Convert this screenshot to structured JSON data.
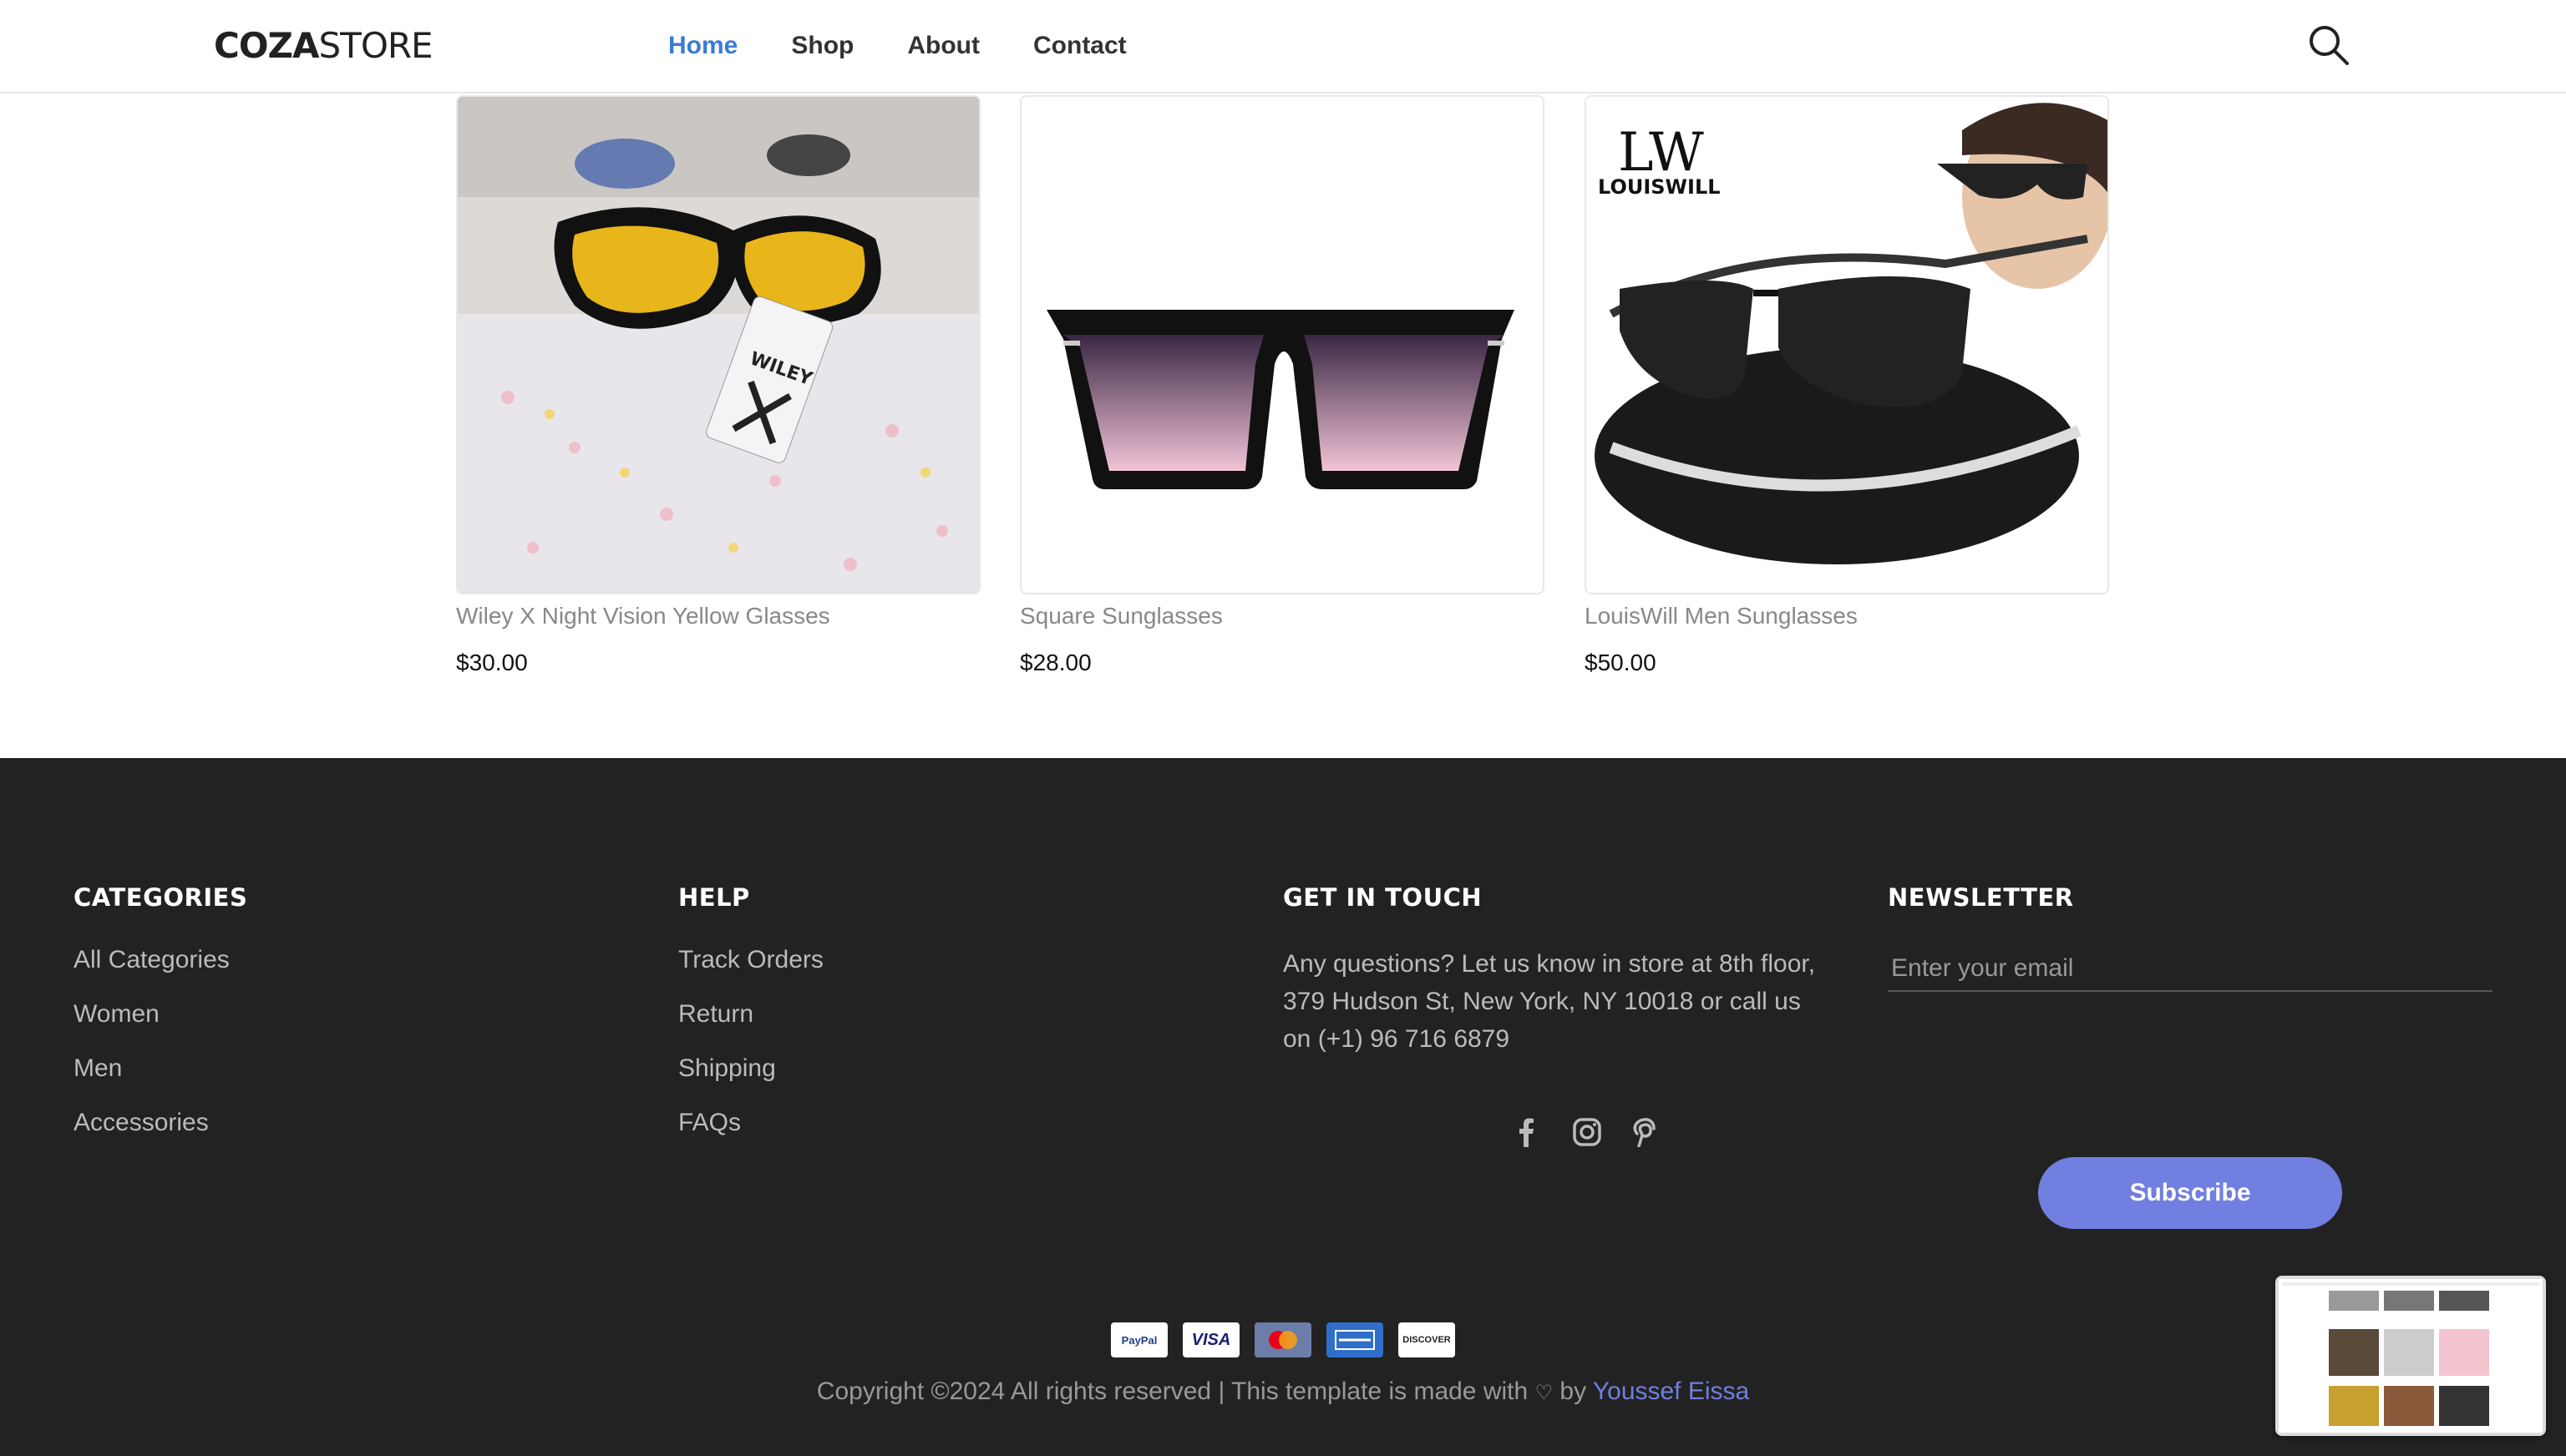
{
  "header": {
    "logo_bold": "COZA",
    "logo_light": "STORE",
    "nav": [
      "Home",
      "Shop",
      "About",
      "Contact"
    ]
  },
  "products": [
    {
      "name": "Wiley X Night Vision Yellow Glasses",
      "price": "$30.00"
    },
    {
      "name": "Square Sunglasses",
      "price": "$28.00"
    },
    {
      "name": "LouisWill Men Sunglasses",
      "price": "$50.00",
      "brand_logo": "LW LOUISWILL"
    }
  ],
  "footer": {
    "categories": {
      "title": "CATEGORIES",
      "items": [
        "All Categories",
        "Women",
        "Men",
        "Accessories"
      ]
    },
    "help": {
      "title": "HELP",
      "items": [
        "Track Orders",
        "Return",
        "Shipping",
        "FAQs"
      ]
    },
    "touch": {
      "title": "GET IN TOUCH",
      "text": "Any questions? Let us know in store at 8th floor, 379 Hudson St, New York, NY 10018 or call us on (+1) 96 716 6879",
      "socials": [
        "facebook-icon",
        "instagram-icon",
        "pinterest-icon"
      ]
    },
    "newsletter": {
      "title": "NEWSLETTER",
      "placeholder": "Enter your email",
      "button": "Subscribe"
    },
    "payments": [
      "PayPal",
      "VISA",
      "MasterCard",
      "American Express",
      "Discover"
    ],
    "copyright_text": "Copyright ©2024 All rights reserved | This template is made with",
    "copyright_by": "by",
    "author": "Youssef Eissa"
  },
  "colors": {
    "accent": "#717fe0",
    "nav_active": "#3a7bd5",
    "footer_bg": "#222222"
  }
}
